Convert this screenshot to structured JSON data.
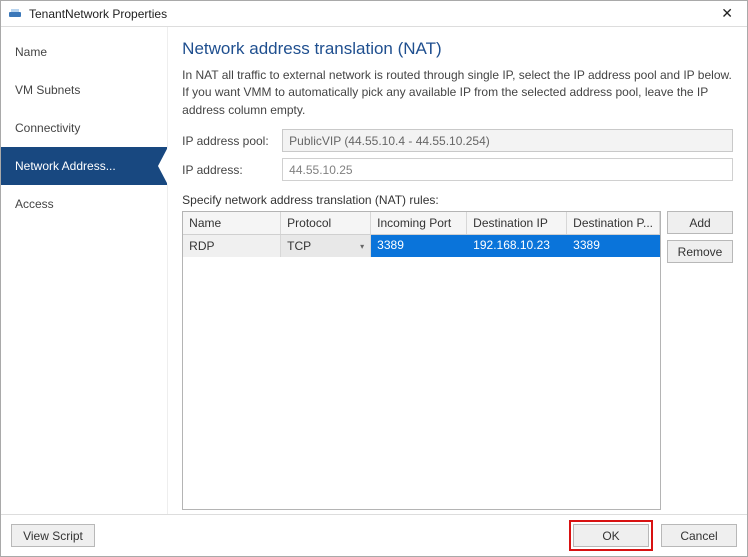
{
  "titlebar": {
    "title": "TenantNetwork Properties"
  },
  "sidebar": {
    "items": [
      {
        "label": "Name"
      },
      {
        "label": "VM Subnets"
      },
      {
        "label": "Connectivity"
      },
      {
        "label": "Network Address..."
      },
      {
        "label": "Access"
      }
    ],
    "activeIndex": 3
  },
  "main": {
    "heading": "Network address translation (NAT)",
    "desc": "In NAT all traffic to external network is routed through single IP, select the IP address pool and IP below. If you want VMM to automatically pick any available IP from the selected address pool, leave the IP address column empty.",
    "ipPool": {
      "label": "IP address pool:",
      "value": "PublicVIP (44.55.10.4 - 44.55.10.254)"
    },
    "ipAddr": {
      "label": "IP address:",
      "value": "44.55.10.25"
    },
    "rulesLabel": "Specify network address translation (NAT) rules:",
    "grid": {
      "headers": [
        "Name",
        "Protocol",
        "Incoming Port",
        "Destination IP",
        "Destination P..."
      ],
      "rows": [
        {
          "name": "RDP",
          "protocol": "TCP",
          "incoming": "3389",
          "destIp": "192.168.10.23",
          "destPort": "3389",
          "selected": true
        }
      ]
    },
    "buttons": {
      "add": "Add",
      "remove": "Remove"
    }
  },
  "bottom": {
    "viewScript": "View Script",
    "ok": "OK",
    "cancel": "Cancel"
  }
}
